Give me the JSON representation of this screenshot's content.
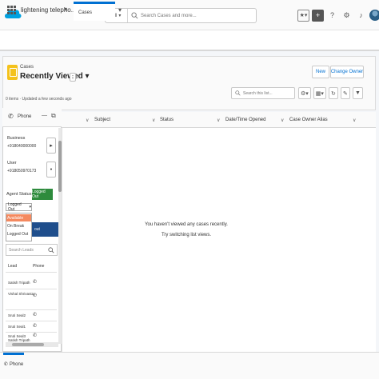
{
  "header": {
    "search_scope": "All",
    "search_placeholder": "Search Cases and more..."
  },
  "nav": {
    "app_name": "lightening telepho...",
    "tab_label": "Cases"
  },
  "list": {
    "object_label": "Cases",
    "view_name": "Recently Viewed",
    "new_button": "New",
    "change_owner_button": "Change Owner",
    "status_text": "0 items · Updated a few seconds ago",
    "search_placeholder": "Search this list...",
    "columns": [
      "Subject",
      "Status",
      "Date/Time Opened",
      "Case Owner Alias"
    ],
    "empty_line1": "You haven't viewed any cases recently.",
    "empty_line2": "Try switching list views."
  },
  "softphone": {
    "title": "Phone",
    "business_label": "Business",
    "business_number": "+918040000000",
    "user_label": "User",
    "user_number": "+918050970173",
    "agent_status_label": "Agent Status:",
    "logged_out_button": "Logged Out",
    "status_select_value": "Logged Out",
    "status_options": [
      "Available",
      "On Break",
      "Logged Out"
    ],
    "blue_bar_text": "out",
    "search_placeholder": "Search Leads",
    "lead_columns": [
      "Lead",
      "Phone"
    ],
    "leads": [
      "Satish Tripath",
      "Vishal Shrivasta...",
      "Sruti Seal2",
      "Sruti Seal1",
      "Sruti Seal3",
      "Satish Tripath"
    ]
  },
  "utility": {
    "phone_label": "Phone"
  },
  "colors": {
    "brand": "#00a1e0",
    "active_tab": "#0070d2",
    "logged_out": "#2e8b3d",
    "case_icon": "#f4c21b",
    "available_highlight": "#f4895f"
  }
}
